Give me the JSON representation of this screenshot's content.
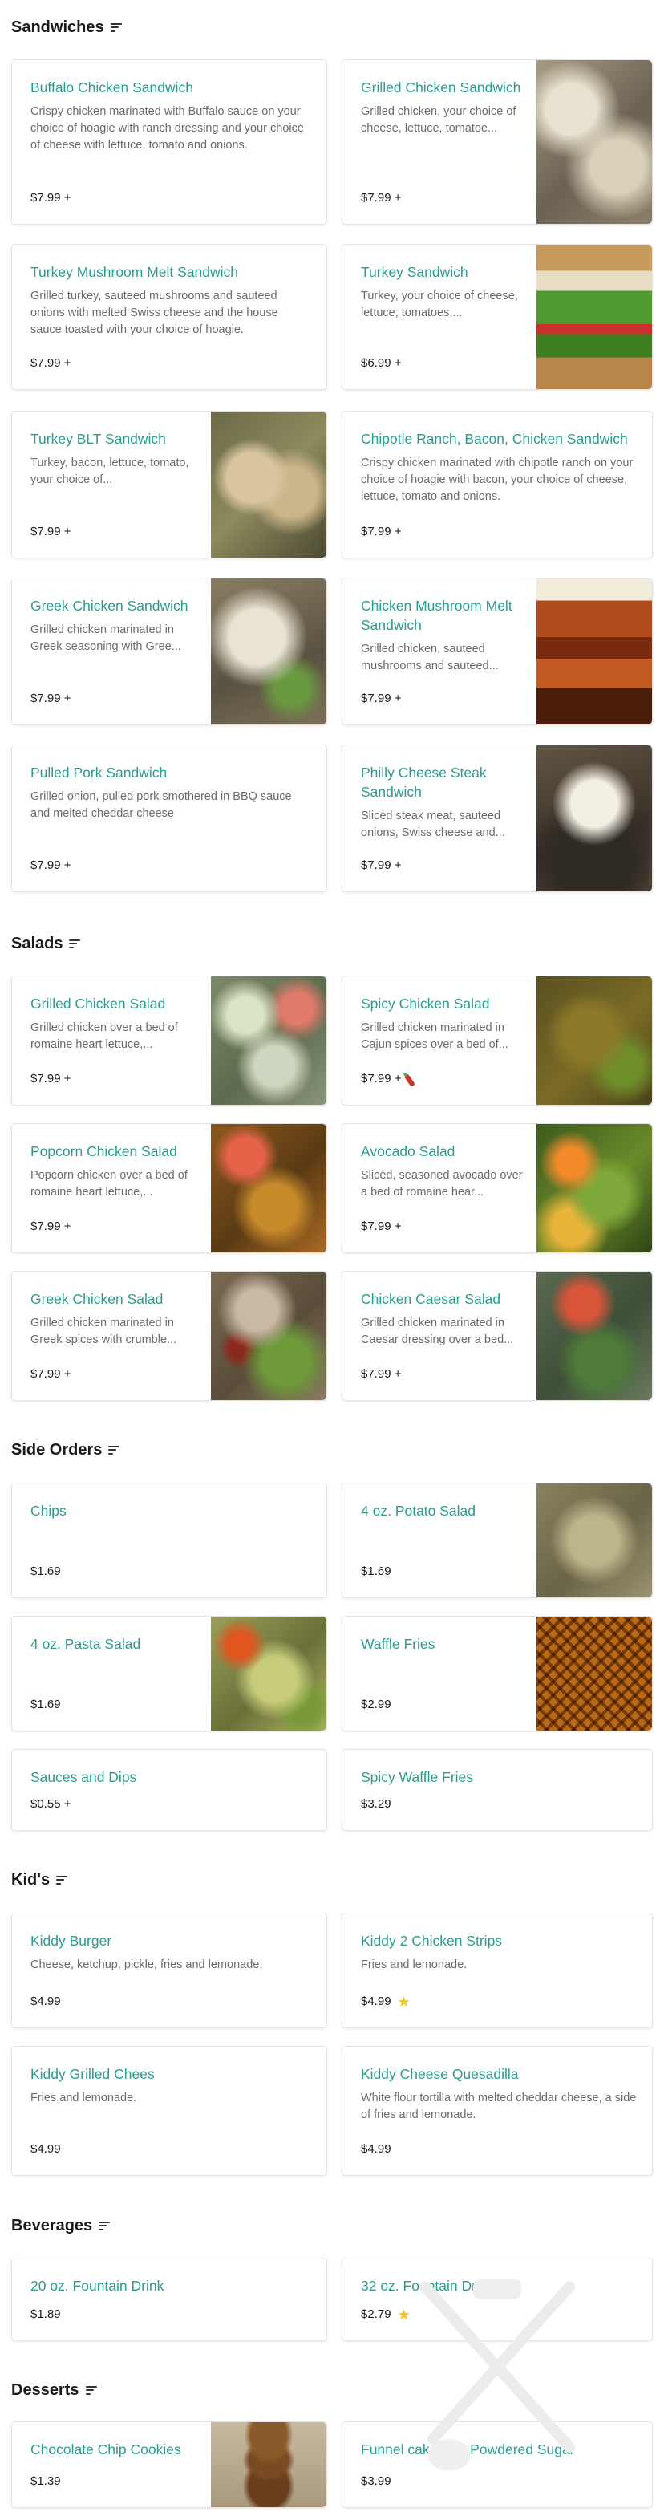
{
  "sections": {
    "sandwiches": {
      "title": "Sandwiches",
      "items": [
        {
          "name": "Buffalo Chicken Sandwich",
          "desc": "Crispy chicken marinated with Buffalo sauce on your choice of hoagie with ranch dressing and your choice of cheese with lettuce, tomato and onions.",
          "price": "$7.99 +"
        },
        {
          "name": "Grilled Chicken Sandwich",
          "desc": "Grilled chicken, your choice of cheese, lettuce, tomatoe...",
          "price": "$7.99 +",
          "image": "grilled chicken"
        },
        {
          "name": "Turkey Mushroom Melt Sandwich",
          "desc": "Grilled turkey, sauteed mushrooms and sauteed onions with melted Swiss cheese and the house sauce toasted with your choice of hoagie.",
          "price": "$7.99 +"
        },
        {
          "name": "Turkey Sandwich",
          "desc": "Turkey, your choice of cheese, lettuce, tomatoes,...",
          "price": "$6.99 +",
          "image": "turkey sandwich"
        },
        {
          "name": "Turkey BLT Sandwich",
          "desc": "Turkey, bacon, lettuce, tomato, your choice of...",
          "price": "$7.99 +",
          "image": "turkey BLT"
        },
        {
          "name": "Chipotle Ranch, Bacon, Chicken Sandwich",
          "desc": "Crispy chicken marinated with chipotle ranch on your choice of hoagie with bacon, your choice of cheese, lettuce, tomato and onions.",
          "price": "$7.99 +"
        },
        {
          "name": "Greek Chicken Sandwich",
          "desc": "Grilled chicken marinated in Greek seasoning with Gree...",
          "price": "$7.99 +",
          "image": "greek chicken sandwich"
        },
        {
          "name": "Chicken Mushroom Melt Sandwich",
          "desc": "Grilled chicken, sauteed mushrooms and sauteed...",
          "price": "$7.99 +",
          "image": "chicken mushroom melt"
        },
        {
          "name": "Pulled Pork Sandwich",
          "desc": "Grilled onion, pulled pork smothered in BBQ sauce and melted cheddar cheese",
          "price": "$7.99 +"
        },
        {
          "name": "Philly Cheese Steak Sandwich",
          "desc": "Sliced steak meat, sauteed onions, Swiss cheese and...",
          "price": "$7.99 +",
          "image": "philly cheese steak"
        }
      ]
    },
    "salads": {
      "title": "Salads",
      "items": [
        {
          "name": "Grilled Chicken Salad",
          "desc": "Grilled chicken over a bed of romaine heart lettuce,...",
          "price": "$7.99 +",
          "image": "grilled chicken salad"
        },
        {
          "name": "Spicy Chicken Salad",
          "desc": "Grilled chicken marinated in Cajun spices over a bed of...",
          "price": "$7.99 +",
          "image": "spicy chicken salad",
          "badge": "pepper-icon"
        },
        {
          "name": "Popcorn Chicken Salad",
          "desc": "Popcorn chicken over a bed of romaine heart lettuce,...",
          "price": "$7.99 +",
          "image": "popcorn chicken salad"
        },
        {
          "name": "Avocado Salad",
          "desc": "Sliced, seasoned avocado over a bed of romaine hear...",
          "price": "$7.99 +",
          "image": "avocado salad"
        },
        {
          "name": "Greek Chicken Salad",
          "desc": "Grilled chicken marinated in Greek spices with crumble...",
          "price": "$7.99 +",
          "image": "greek chicken salad"
        },
        {
          "name": "Chicken Caesar Salad",
          "desc": "Grilled chicken marinated in Caesar dressing over a bed...",
          "price": "$7.99 +",
          "image": "chicken caesar salad"
        }
      ]
    },
    "sides": {
      "title": "Side Orders",
      "items": [
        {
          "name": "Chips",
          "desc": "",
          "price": "$1.69"
        },
        {
          "name": "4 oz. Potato Salad",
          "desc": "",
          "price": "$1.69",
          "image": "potato salad"
        },
        {
          "name": "4 oz. Pasta Salad",
          "desc": "",
          "price": "$1.69",
          "image": "pasta salad"
        },
        {
          "name": "Waffle Fries",
          "desc": "",
          "price": "$2.99",
          "image": "waffle fries"
        },
        {
          "name": "Sauces and Dips",
          "desc": "",
          "price": "$0.55 +"
        },
        {
          "name": "Spicy Waffle Fries",
          "desc": "",
          "price": "$3.29"
        }
      ]
    },
    "kids": {
      "title": "Kid's",
      "items": [
        {
          "name": "Kiddy Burger",
          "desc": "Cheese, ketchup, pickle, fries and lemonade.",
          "price": "$4.99"
        },
        {
          "name": "Kiddy 2 Chicken Strips",
          "desc": "Fries and lemonade.",
          "price": "$4.99",
          "badge": "star-icon"
        },
        {
          "name": "Kiddy Grilled Chees",
          "desc": "Fries and lemonade.",
          "price": "$4.99"
        },
        {
          "name": "Kiddy Cheese Quesadilla",
          "desc": "White flour tortilla with melted cheddar cheese, a side of fries and lemonade.",
          "price": "$4.99"
        }
      ]
    },
    "beverages": {
      "title": "Beverages",
      "items": [
        {
          "name": "20 oz. Fountain Drink",
          "desc": "",
          "price": "$1.89"
        },
        {
          "name": "32 oz. Fountain Drink",
          "desc": "",
          "price": "$2.79",
          "badge": "star-icon"
        }
      ]
    },
    "desserts": {
      "title": "Desserts",
      "items": [
        {
          "name": "Chocolate Chip Cookies",
          "desc": "",
          "price": "$1.39",
          "image": "chocolate chip cookies"
        },
        {
          "name": "Funnel cake with Powdered Sugar",
          "desc": "",
          "price": "$3.99"
        }
      ]
    }
  },
  "icons": {
    "star": "★"
  },
  "colors": {
    "item_name": "#2a9d8f",
    "star": "#f5c518",
    "pepper": "#d32f2f"
  }
}
